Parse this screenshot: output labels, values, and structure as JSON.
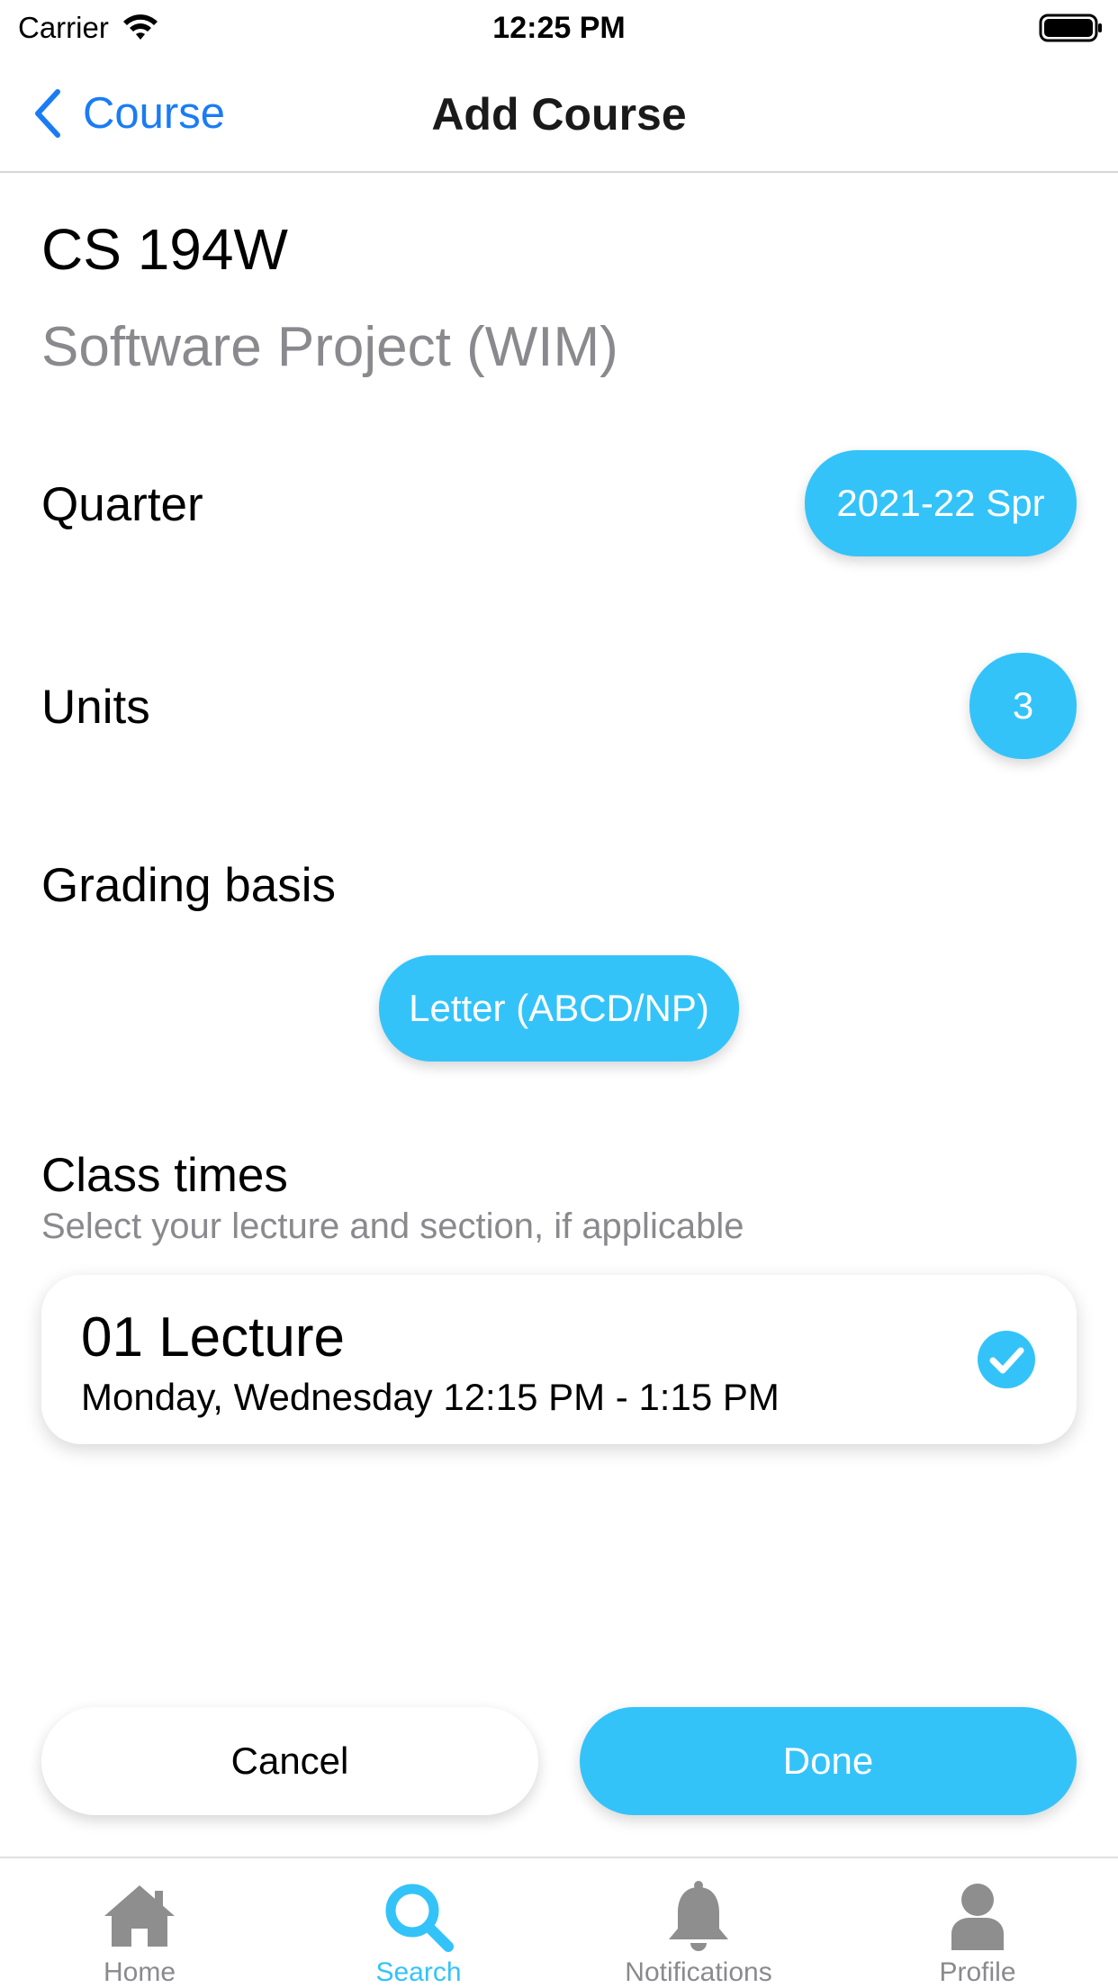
{
  "status_bar": {
    "carrier": "Carrier",
    "time": "12:25 PM"
  },
  "nav": {
    "back_label": "Course",
    "title": "Add Course"
  },
  "course": {
    "code": "CS 194W",
    "name": "Software Project (WIM)"
  },
  "quarter": {
    "label": "Quarter",
    "value": "2021-22 Spr"
  },
  "units": {
    "label": "Units",
    "value": "3"
  },
  "grading": {
    "label": "Grading basis",
    "value": "Letter (ABCD/NP)"
  },
  "class_times": {
    "title": "Class times",
    "subtitle": "Select your lecture and section, if applicable",
    "items": [
      {
        "title": "01 Lecture",
        "times": "Monday, Wednesday 12:15 PM - 1:15 PM",
        "selected": true
      }
    ]
  },
  "actions": {
    "cancel_label": "Cancel",
    "done_label": "Done"
  },
  "tabs": [
    {
      "label": "Home",
      "icon": "home-icon",
      "active": false
    },
    {
      "label": "Search",
      "icon": "search-icon",
      "active": true
    },
    {
      "label": "Notifications",
      "icon": "bell-icon",
      "active": false
    },
    {
      "label": "Profile",
      "icon": "person-icon",
      "active": false
    }
  ],
  "colors": {
    "accent": "#33c3f9",
    "ios_blue": "#1a7cf5",
    "secondary_text": "#8a8a8e",
    "inactive_icon": "#8e8e8e"
  }
}
